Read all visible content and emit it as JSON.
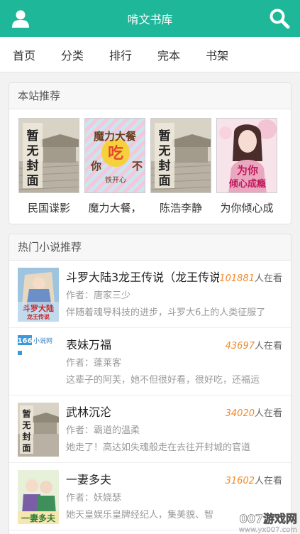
{
  "header": {
    "title": "啃文书库",
    "user_icon": "user-icon",
    "search_icon": "search-icon",
    "color": "#1fb79a"
  },
  "nav": {
    "items": [
      "首页",
      "分类",
      "排行",
      "完本",
      "书架"
    ]
  },
  "recommend": {
    "heading": "本站推荐",
    "books": [
      {
        "title": "民国谍影",
        "cover_text": "暂无封面"
      },
      {
        "title": "魔力大餐，",
        "cover_text": "魔力大餐你吃不",
        "cover_author": "铁开心"
      },
      {
        "title": "陈浩李静",
        "cover_text": "暂无封面"
      },
      {
        "title": "为你倾心成",
        "cover_text": "为你倾心成瘾"
      }
    ]
  },
  "hot": {
    "heading": "热门小说推荐",
    "readers_suffix": "人在看",
    "author_prefix": "作者：",
    "items": [
      {
        "title": "斗罗大陆3龙王传说（龙王传说）",
        "readers": "101881",
        "author": "唐家三少",
        "desc": "伴随着魂导科技的进步，斗罗大6上的人类征服了",
        "cover_text": "斗罗大陆龙王传说"
      },
      {
        "title": "表妹万福",
        "readers": "43697",
        "author": "蓬莱客",
        "desc": "这辈子的阿芙，她不但很好看，很好吃，还福运",
        "cover_text": "166小说网"
      },
      {
        "title": "武林沉沦",
        "readers": "34020",
        "author": "霸道的温柔",
        "desc": "她走了！高达如失魂般走在去往开封城的官道",
        "cover_text": "暂无封面"
      },
      {
        "title": "一妻多夫",
        "readers": "31602",
        "author": "妖娆瑟",
        "desc": "她天皇娱乐皇牌经纪人，集美貌、智",
        "cover_text": "一妻多夫"
      }
    ]
  },
  "watermark": {
    "text": "007游戏网",
    "url": "www.yx007.com"
  }
}
